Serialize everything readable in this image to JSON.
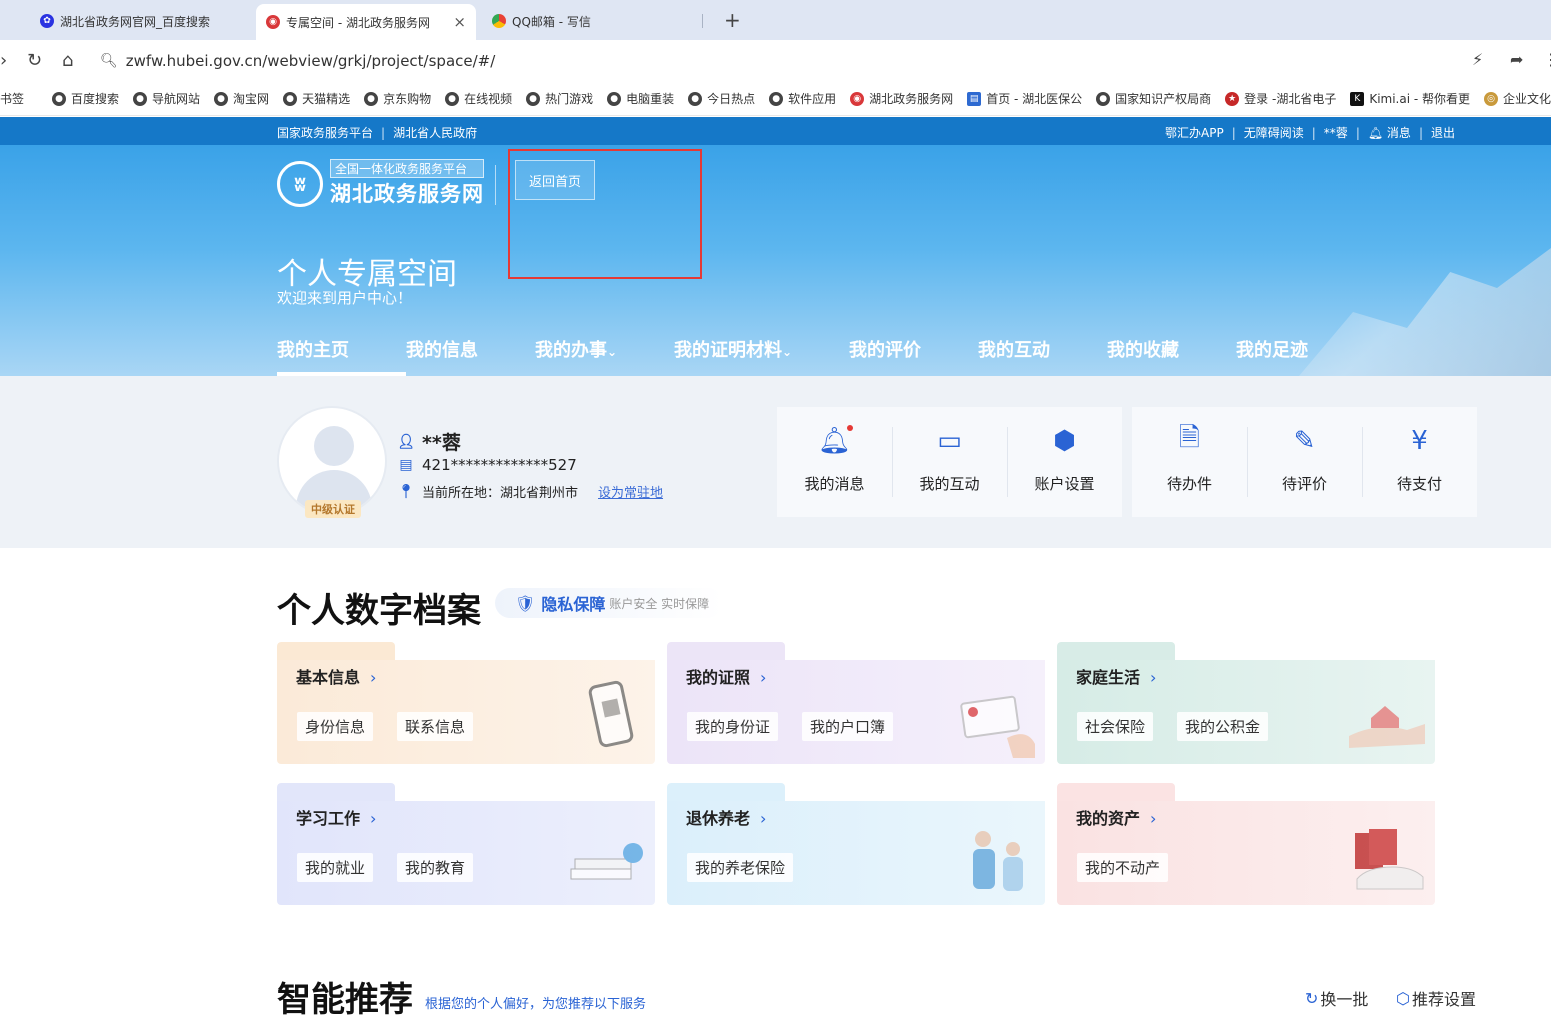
{
  "browser": {
    "tabs": [
      {
        "label": "湖北省政务网官网_百度搜索"
      },
      {
        "label": "专属空间 - 湖北政务服务网",
        "close": "×"
      },
      {
        "label": "QQ邮箱 - 写信"
      }
    ],
    "new_tab": "+",
    "url": "zwfw.hubei.gov.cn/webview/grkj/project/space/#/",
    "bookmarks": [
      "书签",
      "百度搜索",
      "导航网站",
      "淘宝网",
      "天猫精选",
      "京东购物",
      "在线视频",
      "热门游戏",
      "电脑重装",
      "今日热点",
      "软件应用",
      "湖北政务服务网",
      "首页 - 湖北医保公",
      "国家知识产权局商",
      "登录 -湖北省电子",
      "Kimi.ai - 帮你看更",
      "企业文化"
    ]
  },
  "site_top": {
    "left_links": [
      "国家政务服务平台",
      "湖北省人民政府"
    ],
    "right_links": [
      "鄂汇办APP",
      "无障碍阅读",
      "**蓉",
      "消息",
      "退出"
    ]
  },
  "header": {
    "logo_sub": "全国一体化政务服务平台",
    "logo_main": "湖北政务服务网",
    "back_home": "返回首页",
    "title": "个人专属空间",
    "subtitle": "欢迎来到用户中心！",
    "nav": [
      "我的主页",
      "我的信息",
      "我的办事",
      "我的证明材料",
      "我的评价",
      "我的互动",
      "我的收藏",
      "我的足迹"
    ],
    "nav_dropdown_mark": "⌄"
  },
  "user": {
    "badge": "中级认证",
    "name": "**蓉",
    "id_number": "421*************527",
    "location_label": "当前所在地：湖北省荆州市",
    "set_resident": "设为常驻地"
  },
  "quick_left": [
    {
      "label": "我的消息",
      "icon": "bell-icon"
    },
    {
      "label": "我的互动",
      "icon": "chat-icon"
    },
    {
      "label": "账户设置",
      "icon": "settings-icon"
    }
  ],
  "quick_right": [
    {
      "label": "待办件",
      "icon": "search-doc-icon"
    },
    {
      "label": "待评价",
      "icon": "edit-icon"
    },
    {
      "label": "待支付",
      "icon": "payment-icon"
    }
  ],
  "archive": {
    "title": "个人数字档案",
    "privacy_main": "隐私保障",
    "privacy_sub": "账户安全 实时保障",
    "cards": [
      {
        "title": "基本信息",
        "chips": [
          "身份信息",
          "联系信息"
        ]
      },
      {
        "title": "我的证照",
        "chips": [
          "我的身份证",
          "我的户口簿"
        ]
      },
      {
        "title": "家庭生活",
        "chips": [
          "社会保险",
          "我的公积金"
        ]
      },
      {
        "title": "学习工作",
        "chips": [
          "我的就业",
          "我的教育"
        ]
      },
      {
        "title": "退休养老",
        "chips": [
          "我的养老保险"
        ]
      },
      {
        "title": "我的资产",
        "chips": [
          "我的不动产"
        ]
      }
    ],
    "arrow": "›"
  },
  "recommend": {
    "title": "智能推荐",
    "subtitle": "根据您的个人偏好，为您推荐以下服务",
    "refresh": "换一批",
    "settings": "推荐设置"
  },
  "colors": {
    "primary": "#2a63d4",
    "topbar": "#1578c8",
    "highlight_box": "#e53935"
  }
}
